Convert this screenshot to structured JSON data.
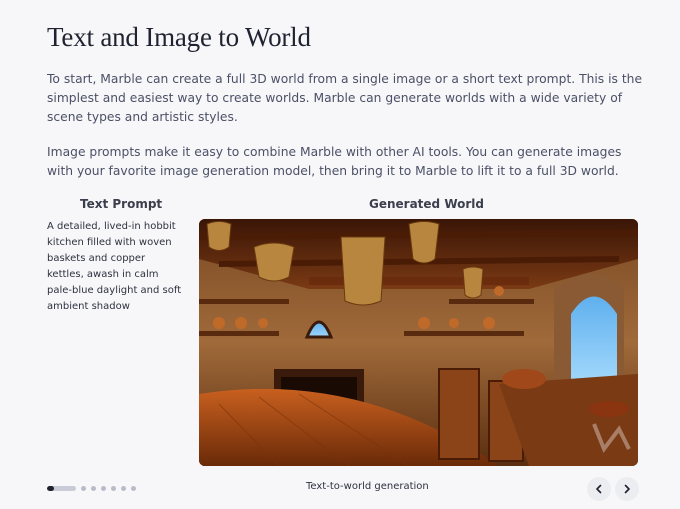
{
  "section": {
    "title": "Text and Image to World",
    "paragraph1": "To start, Marble can create a full 3D world from a single image or a short text prompt. This is the simplest and easiest way to create worlds. Marble can generate worlds with a wide variety of scene types and artistic styles.",
    "paragraph2": "Image prompts make it easy to combine Marble with other AI tools. You can generate images with your favorite image generation model, then bring it to Marble to lift it to a full 3D world."
  },
  "demo": {
    "prompt_heading": "Text Prompt",
    "prompt_text": "A detailed, lived-in hobbit kitchen filled with woven baskets and copper kettles, awash in calm pale-blue daylight and soft ambient shadow",
    "world_heading": "Generated World",
    "caption": "Text-to-world generation",
    "carousel": {
      "slide_count": 7,
      "active_index": 0,
      "active_progress": 0.25
    }
  },
  "colors": {
    "background": "#f7f7f9",
    "heading": "#1f2230",
    "body_text": "#4b5066",
    "dot_active": "#1e2130",
    "dot_inactive": "#b9bcc8"
  },
  "icons": {
    "prev": "chevron-left-icon",
    "next": "chevron-right-icon"
  }
}
